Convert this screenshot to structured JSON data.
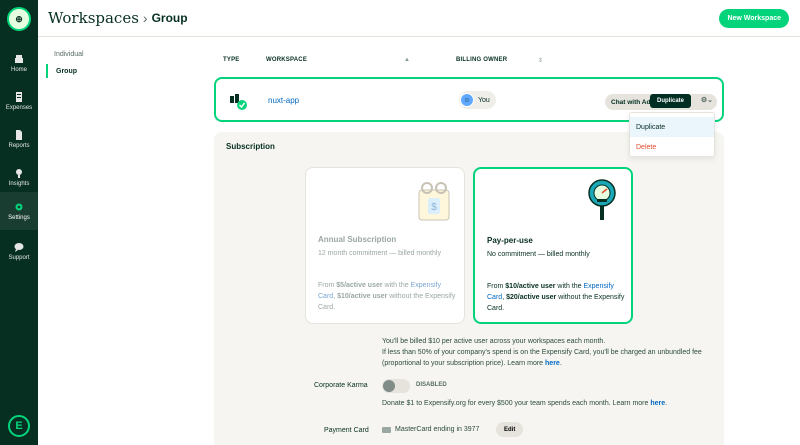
{
  "nav": {
    "items": [
      {
        "label": "Home"
      },
      {
        "label": "Expenses"
      },
      {
        "label": "Reports"
      },
      {
        "label": "Insights"
      },
      {
        "label": "Settings"
      },
      {
        "label": "Support"
      }
    ]
  },
  "header": {
    "title": "Workspaces",
    "subtitle": "Group",
    "new_workspace": "New Workspace"
  },
  "subnav": {
    "items": [
      {
        "label": "Individual"
      },
      {
        "label": "Group"
      }
    ]
  },
  "table": {
    "columns": {
      "type": "TYPE",
      "workspace": "WORKSPACE",
      "billing_owner": "BILLING OWNER"
    },
    "row": {
      "name": "nuxt-app",
      "owner": "You",
      "chat_button": "Chat with Ad"
    }
  },
  "tooltip": "Duplicate",
  "menu": {
    "items": [
      {
        "label": "Duplicate"
      },
      {
        "label": "Delete"
      }
    ]
  },
  "subscription": {
    "title": "Subscription",
    "annual": {
      "title": "Annual Subscription",
      "subtitle": "12 month commitment — billed monthly",
      "desc_pre": "From ",
      "desc_price1": "$5/active user",
      "desc_mid": " with the ",
      "desc_link": "Expensify Card",
      "desc_sep": ", ",
      "desc_price2": "$10/active user",
      "desc_post": " without the Expensify Card."
    },
    "ppu": {
      "title": "Pay-per-use",
      "subtitle": "No commitment — billed monthly",
      "desc_pre": "From ",
      "desc_price1": "$10/active user",
      "desc_mid": " with the ",
      "desc_link": "Expensify Card",
      "desc_sep": ", ",
      "desc_price2": "$20/active user",
      "desc_post": " without the Expensify Card."
    },
    "note_line1": "You'll be billed $10 per active user across your workspaces each month.",
    "note_line2": "If less than 50% of your company's spend is on the Expensify Card, you'll be charged an unbundled fee (proportional to your subscription price). Learn more ",
    "note_link": "here",
    "note_end": ".",
    "karma_label": "Corporate Karma",
    "karma_state": "DISABLED",
    "karma_note": "Donate $1 to Expensify.org for every $500 your team spends each month. Learn more ",
    "karma_link": "here",
    "karma_end": ".",
    "payment_label": "Payment Card",
    "payment_value": "MasterCard ending in 3977",
    "edit": "Edit"
  },
  "colors": {
    "accent": "#03d47c",
    "dark": "#062f22",
    "link": "#0068c2",
    "danger": "#e24b2e"
  }
}
